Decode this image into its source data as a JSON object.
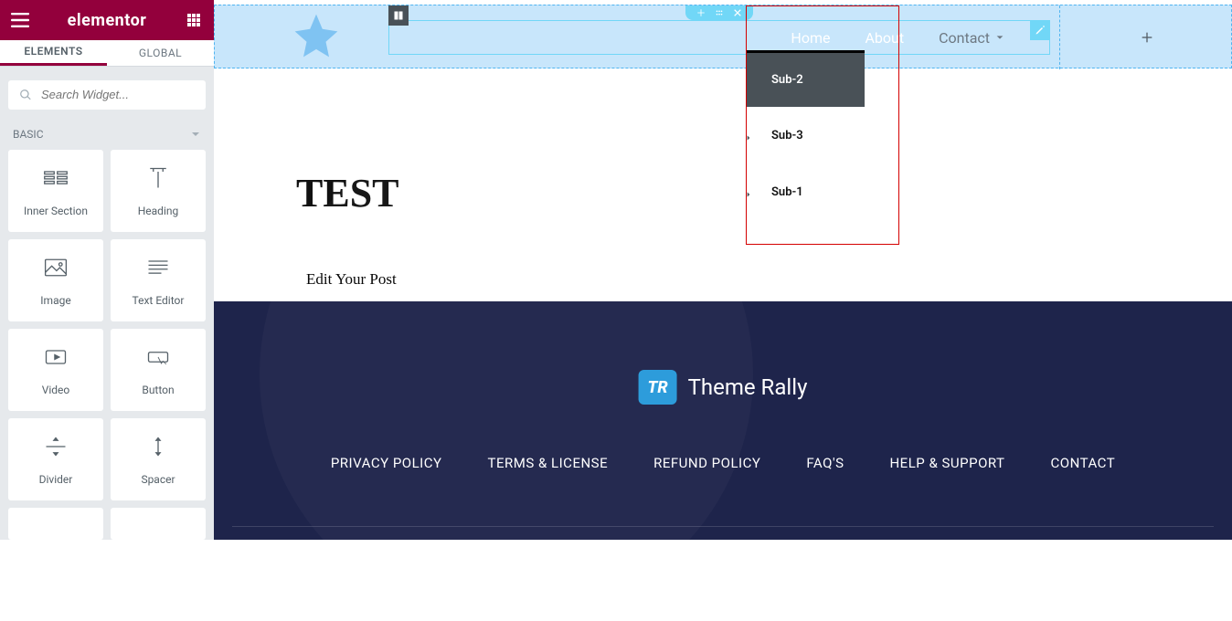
{
  "panel": {
    "brand": "elementor",
    "tabs": {
      "elements": "ELEMENTS",
      "global": "GLOBAL"
    },
    "search_placeholder": "Search Widget...",
    "category": "BASIC",
    "widgets": [
      {
        "id": "inner-section",
        "label": "Inner Section"
      },
      {
        "id": "heading",
        "label": "Heading"
      },
      {
        "id": "image",
        "label": "Image"
      },
      {
        "id": "text-editor",
        "label": "Text Editor"
      },
      {
        "id": "video",
        "label": "Video"
      },
      {
        "id": "button",
        "label": "Button"
      },
      {
        "id": "divider",
        "label": "Divider"
      },
      {
        "id": "spacer",
        "label": "Spacer"
      }
    ]
  },
  "canvas": {
    "nav": {
      "home": "Home",
      "about": "About",
      "contact": "Contact"
    },
    "submenu": [
      "Sub-2",
      "Sub-3",
      "Sub-1"
    ],
    "heading": "TEST",
    "edit_post": "Edit Your Post"
  },
  "footer": {
    "logo_badge": "TR",
    "logo_text": "Theme Rally",
    "links": [
      "PRIVACY POLICY",
      "TERMS & LICENSE",
      "REFUND POLICY",
      "FAQ'S",
      "HELP & SUPPORT",
      "CONTACT"
    ]
  }
}
